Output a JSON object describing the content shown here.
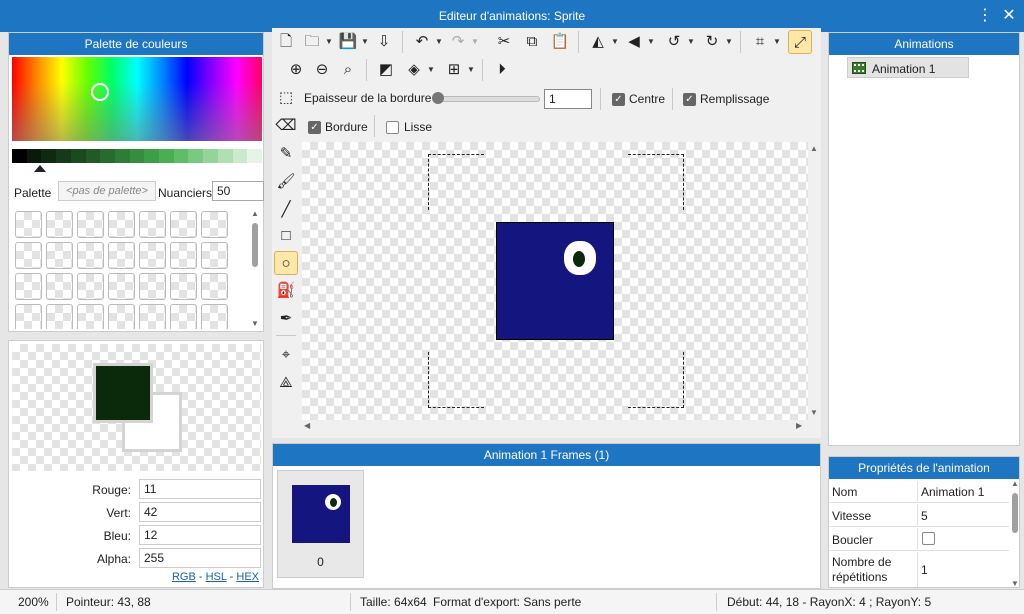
{
  "window": {
    "title": "Editeur d'animations: Sprite",
    "menu_icon": "⋮",
    "close_icon": "✕"
  },
  "palette": {
    "header": "Palette de couleurs",
    "palette_label": "Palette",
    "palette_value": "<pas de palette>",
    "nuances_label": "Nuanciers",
    "nuances_value": "50",
    "shades": [
      "#000000",
      "#0a1a0a",
      "#0f2a10",
      "#15391a",
      "#1b4a20",
      "#215a27",
      "#286b2e",
      "#2e7c35",
      "#358d3d",
      "#3c9e45",
      "#4aae53",
      "#5fbd68",
      "#79c980",
      "#94d49a",
      "#b0dfb4",
      "#cbe9cd",
      "#e5f4e6"
    ]
  },
  "color": {
    "primary": "#0b2a0c",
    "secondary": "#ffffff",
    "red_label": "Rouge:",
    "red": "11",
    "green_label": "Vert:",
    "green": "42",
    "blue_label": "Bleu:",
    "blue": "12",
    "alpha_label": "Alpha:",
    "alpha": "255",
    "mode_rgb": "RGB",
    "mode_hsl": "HSL",
    "mode_hex": "HEX",
    "mode_sep": "-"
  },
  "toolbar": {
    "thickness_label": "Epaisseur de la bordure",
    "thickness_value": "1",
    "center_label": "Centre",
    "fill_label": "Remplissage",
    "border_label": "Bordure",
    "smooth_label": "Lisse"
  },
  "sprite": {
    "background": "#151580",
    "eye_white": "#ffffff",
    "eye_pupil": "#0b2a0c"
  },
  "frames": {
    "header": "Animation 1 Frames (1)",
    "items": [
      {
        "index": "0"
      }
    ]
  },
  "animations": {
    "header": "Animations",
    "items": [
      {
        "name": "Animation 1"
      }
    ]
  },
  "properties": {
    "header": "Propriétés de l'animation",
    "rows": [
      {
        "key": "Nom",
        "value": "Animation 1"
      },
      {
        "key": "Vitesse",
        "value": "5"
      },
      {
        "key": "Boucler",
        "value": ""
      },
      {
        "key_line1": "Nombre de",
        "key_line2": "répétitions",
        "value": "1"
      }
    ]
  },
  "status": {
    "zoom": "200%",
    "pointer": "Pointeur: 43, 88",
    "size": "Taille: 64x64",
    "export": "Format d'export: Sans perte",
    "shape": "Début: 44, 18 - RayonX: 4 ; RayonY: 5"
  }
}
